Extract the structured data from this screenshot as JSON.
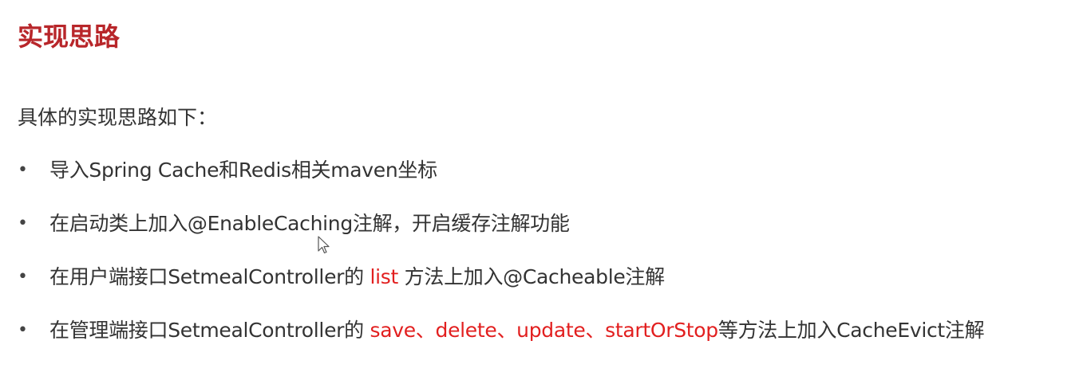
{
  "title": "实现思路",
  "intro": "具体的实现思路如下：",
  "bullet_symbol": "•",
  "bullets": [
    {
      "pre": "导入Spring Cache和Redis相关maven坐标",
      "highlight": "",
      "post": ""
    },
    {
      "pre": "在启动类上加入@EnableCaching注解，开启缓存注解功能",
      "highlight": "",
      "post": ""
    },
    {
      "pre": "在用户端接口SetmealController的 ",
      "highlight": "list",
      "post": " 方法上加入@Cacheable注解"
    },
    {
      "pre": "在管理端接口SetmealController的 ",
      "highlight": "save、delete、update、startOrStop",
      "post": "等方法上加入CacheEvict注解"
    }
  ],
  "colors": {
    "title": "#b8262a",
    "highlight": "#e21f1f",
    "text": "#333333"
  },
  "icons": {
    "cursor": "mouse-pointer-icon"
  }
}
